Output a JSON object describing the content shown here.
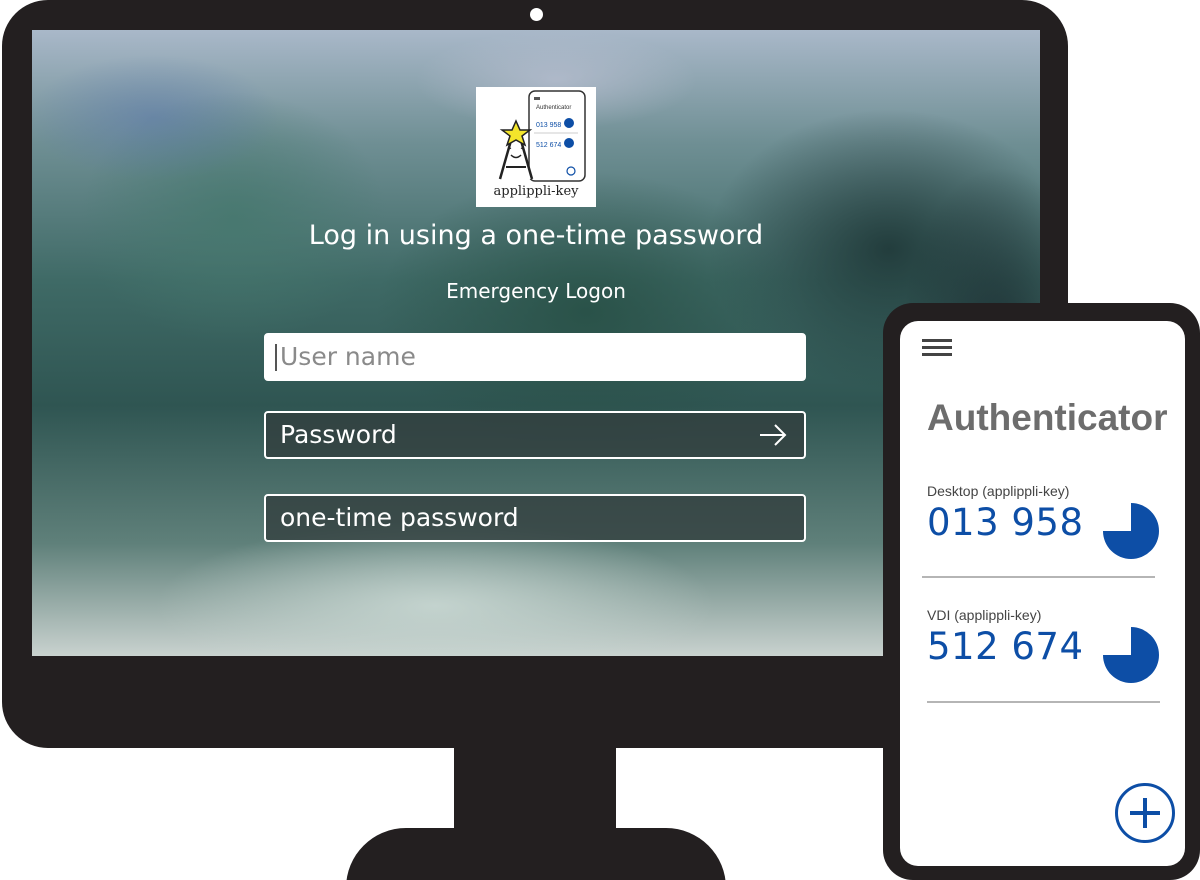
{
  "desktop": {
    "logo": {
      "caption": "applippli-key",
      "mini_phone": {
        "title": "Authenticator",
        "codes": [
          "013 958",
          "512 674"
        ]
      }
    },
    "title": "Log in using a one-time password",
    "subtitle": "Emergency Logon",
    "fields": {
      "username_placeholder": "User name",
      "password_placeholder": "Password",
      "otp_placeholder": "one-time password"
    }
  },
  "phone": {
    "app_title": "Authenticator",
    "accounts": [
      {
        "label": "Desktop (applippli-key)",
        "code": "013 958"
      },
      {
        "label": "VDI (applippli-key)",
        "code": "512 674"
      }
    ],
    "icons": [
      "hamburger-menu-icon",
      "timer-icon",
      "plus-icon"
    ]
  },
  "colors": {
    "device_frame": "#231f20",
    "code_blue": "#0d4ea6",
    "title_gray": "#6d6d6d",
    "star_yellow": "#f3e52b"
  }
}
